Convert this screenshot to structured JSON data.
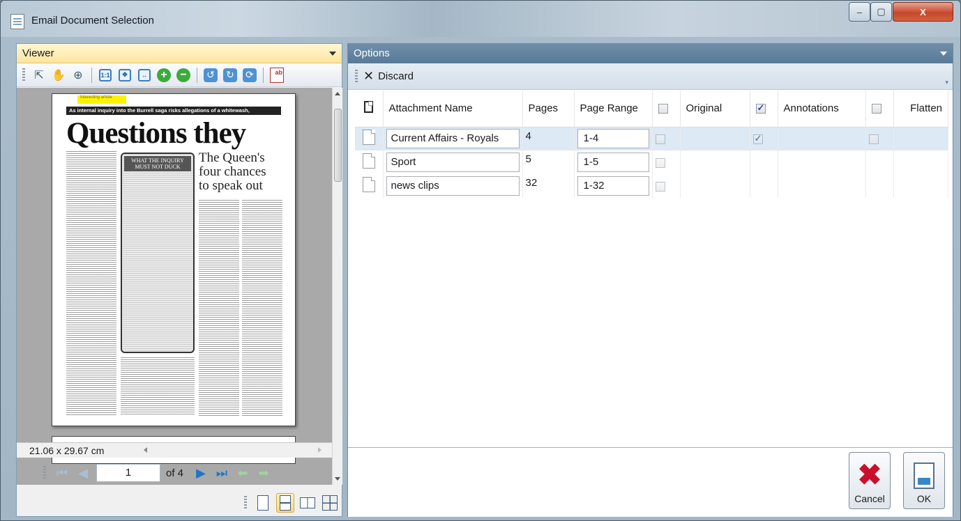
{
  "window": {
    "title": "Email Document Selection",
    "controls": {
      "minimize": "–",
      "maximize": "▢",
      "close": "X"
    }
  },
  "viewer": {
    "header": "Viewer",
    "toolbar_icons": [
      "select-arrow-icon",
      "pan-hand-icon",
      "zoom-icon",
      "actual-size-icon",
      "fit-page-icon",
      "fit-width-icon",
      "zoom-in-icon",
      "zoom-out-icon",
      "rotate-left-icon",
      "rotate-right-icon",
      "rotate-page-icon",
      "pdf-export-icon"
    ],
    "document": {
      "annotation_note": "Interesting article",
      "banner": "As internal inquiry into the Burrell saga risks allegations of a whitewash,",
      "headline": "Questions they",
      "box_title": "WHAT THE INQUIRY MUST NOT DUCK",
      "sub_headline": "The Queen's four chances to speak out"
    },
    "page_size": "21.06 x 29.67 cm",
    "current_page": "1",
    "page_of": "of 4"
  },
  "options": {
    "header": "Options",
    "toolbar": {
      "discard_label": "Discard"
    },
    "columns": {
      "attachment_name": "Attachment Name",
      "pages": "Pages",
      "page_range": "Page Range",
      "original": "Original",
      "annotations": "Annotations",
      "flatten": "Flatten"
    },
    "header_checks": {
      "original": false,
      "annotations": true,
      "flatten": false
    },
    "rows": [
      {
        "name": "Current Affairs - Royals",
        "pages": "4",
        "range": "1-4",
        "original": false,
        "annotations": true,
        "flatten": false,
        "selected": true
      },
      {
        "name": "Sport",
        "pages": "5",
        "range": "1-5",
        "original": false
      },
      {
        "name": "news clips",
        "pages": "32",
        "range": "1-32",
        "original": false
      }
    ],
    "buttons": {
      "cancel": "Cancel",
      "ok": "OK"
    }
  }
}
